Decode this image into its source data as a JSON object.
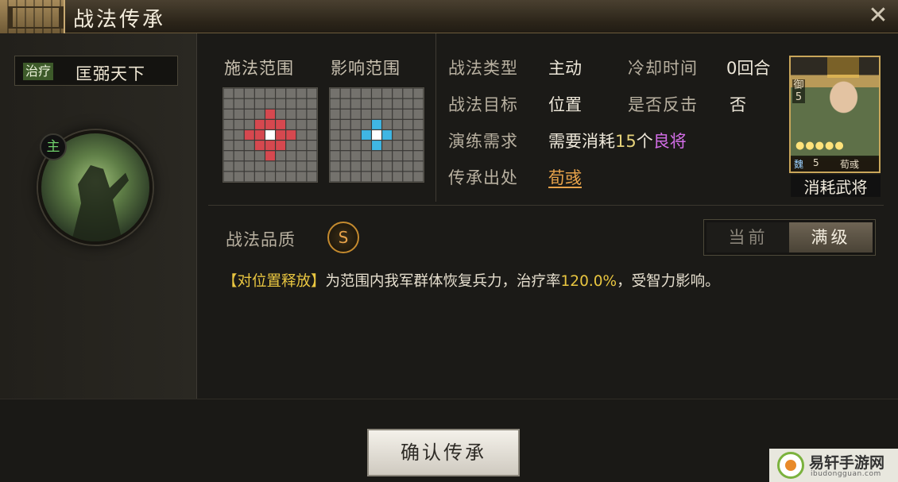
{
  "window": {
    "title": "战法传承",
    "close_icon": "close-icon"
  },
  "skill": {
    "tag": "治疗",
    "name": "匡弼天下",
    "main_badge": "主"
  },
  "range": {
    "cast_label": "施法范围",
    "effect_label": "影响范围",
    "grid_size": 9,
    "cast_cells": [
      [
        4,
        2
      ],
      [
        3,
        3
      ],
      [
        4,
        3
      ],
      [
        5,
        3
      ],
      [
        2,
        4
      ],
      [
        3,
        4
      ],
      [
        5,
        4
      ],
      [
        6,
        4
      ],
      [
        3,
        5
      ],
      [
        4,
        5
      ],
      [
        5,
        5
      ],
      [
        4,
        6
      ]
    ],
    "cast_center": [
      4,
      4
    ],
    "effect_cells": [
      [
        4,
        3
      ],
      [
        3,
        4
      ],
      [
        5,
        4
      ],
      [
        4,
        5
      ]
    ],
    "effect_center": [
      4,
      4
    ],
    "colors": {
      "cast": "#d6484f",
      "effect": "#3fb6e3",
      "center": "#ffffff",
      "cell": "#74726d",
      "line": "#3a3936"
    }
  },
  "info": {
    "type_label": "战法类型",
    "type_value": "主动",
    "cooldown_label": "冷却时间",
    "cooldown_value": "0回合",
    "target_label": "战法目标",
    "target_value": "位置",
    "counter_label": "是否反击",
    "counter_value": "否",
    "drill_label": "演练需求",
    "drill_prefix": "需要消耗",
    "drill_count": "15",
    "drill_unit": "个",
    "drill_item": "良将",
    "source_label": "传承出处",
    "source_value": "荀彧"
  },
  "general": {
    "cost_top": "御",
    "cost_value": "5",
    "stars": "●●●●●",
    "faction": "魏",
    "level": "5",
    "name": "荀彧",
    "caption": "消耗武将"
  },
  "quality": {
    "label": "战法品质",
    "grade": "S"
  },
  "level_toggle": {
    "current": "当前",
    "max": "满级",
    "selected": "满级"
  },
  "description": {
    "prefix": "【对位置释放】",
    "text_a": "为范围内我军群体恢复兵力，治疗率",
    "rate": "120.0%",
    "text_b": "，受智力影响。"
  },
  "confirm_button": "确认传承",
  "watermark": {
    "name": "易轩手游网",
    "domain": "ibudongguan.com"
  }
}
